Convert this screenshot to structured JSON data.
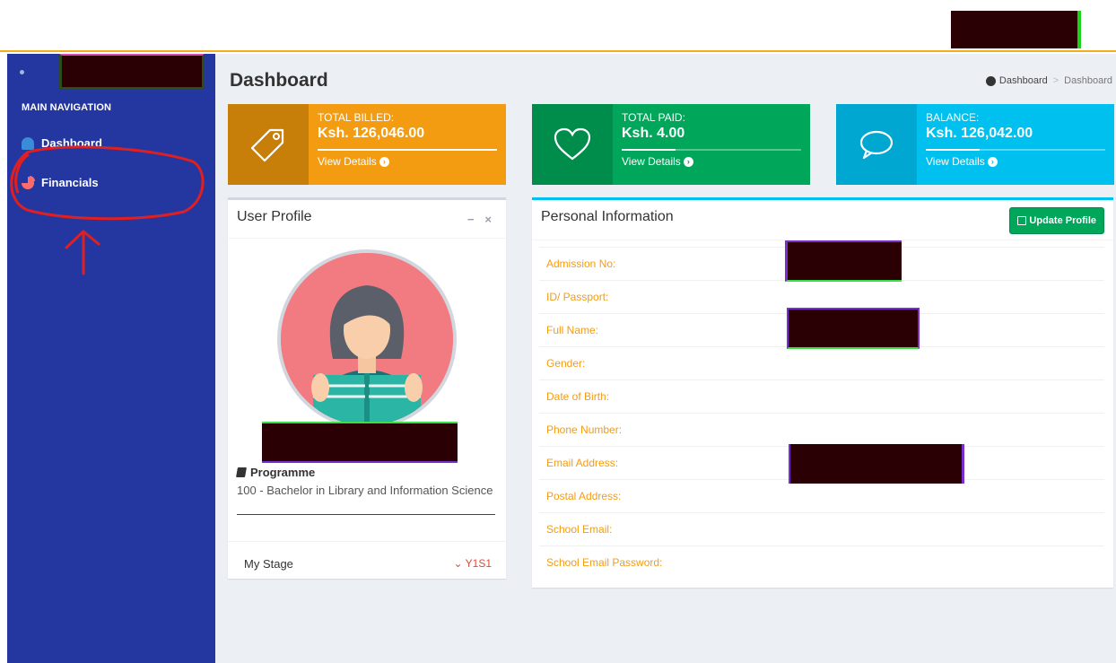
{
  "sidebar": {
    "header": "MAIN NAVIGATION",
    "items": [
      {
        "label": "Dashboard",
        "icon": "dashboard-icon"
      },
      {
        "label": "Financials",
        "icon": "pie-chart-icon",
        "chevron": "‹"
      }
    ]
  },
  "page": {
    "title": "Dashboard",
    "breadcrumb": [
      "Dashboard",
      "Dashboard"
    ]
  },
  "infoboxes": [
    {
      "label": "TOTAL BILLED:",
      "value": "Ksh. 126,046.00",
      "link": "View Details",
      "icon": "tag-icon",
      "color": "#f39c12",
      "progress": 1.0
    },
    {
      "label": "TOTAL PAID:",
      "value": "Ksh. 4.00",
      "link": "View Details",
      "icon": "heart-icon",
      "color": "#00a65a",
      "progress": 0.3
    },
    {
      "label": "BALANCE:",
      "value": "Ksh. 126,042.00",
      "link": "View Details",
      "icon": "comment-icon",
      "color": "#00c0ef",
      "progress": 1.0
    }
  ],
  "profile": {
    "title": "User Profile",
    "tools": {
      "collapse": "−",
      "remove": "×"
    },
    "programme_label": "Programme",
    "programme_value": "100 - Bachelor in Library and Information Science",
    "stage_label": "My Stage",
    "stage_value": "⌄ Y1S1"
  },
  "personal": {
    "title": "Personal Information",
    "update_button": "Update Profile",
    "fields": [
      "Admission No:",
      "ID/ Passport:",
      "Full Name:",
      "Gender:",
      "Date of Birth:",
      "Phone Number:",
      "Email Address:",
      "Postal Address:",
      "School Email:",
      "School Email Password:"
    ]
  },
  "colors": {
    "sidebar_bg": "#2436a0",
    "content_bg": "#ecf0f5",
    "label_orange": "#f39c12",
    "stage_red": "#dd4b39",
    "annotation_red": "#e02020"
  }
}
